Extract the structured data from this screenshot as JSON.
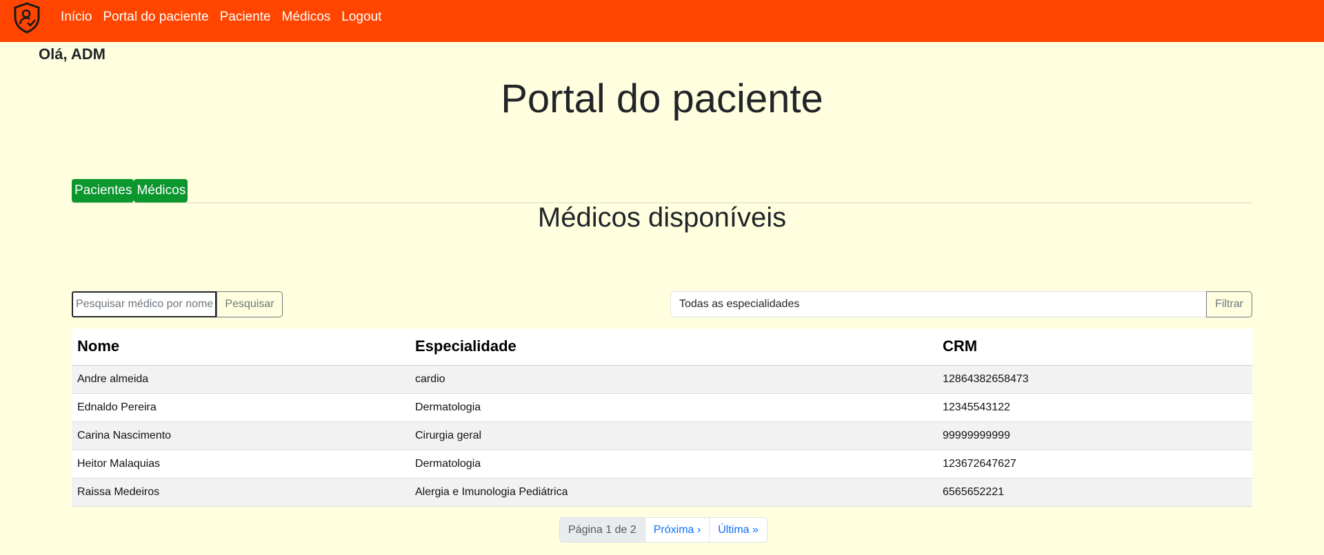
{
  "nav": {
    "links": [
      "Início",
      "Portal do paciente",
      "Paciente",
      "Médicos",
      "Logout"
    ]
  },
  "greeting": "Olá, ADM",
  "page_title": "Portal do paciente",
  "tabs": [
    "Pacientes",
    "Médicos"
  ],
  "section_title": "Médicos disponíveis",
  "search": {
    "placeholder": "Pesquisar médico por nome",
    "button": "Pesquisar"
  },
  "filter": {
    "selected": "Todas as especialidades",
    "button": "Filtrar"
  },
  "table": {
    "headers": [
      "Nome",
      "Especialidade",
      "CRM"
    ],
    "rows": [
      [
        "Andre almeida",
        "cardio",
        "12864382658473"
      ],
      [
        "Ednaldo Pereira",
        "Dermatologia",
        "12345543122"
      ],
      [
        "Carina Nascimento",
        "Cirurgia geral",
        "99999999999"
      ],
      [
        "Heitor Malaquias",
        "Dermatologia",
        "123672647627"
      ],
      [
        "Raissa Medeiros",
        "Alergia e Imunologia Pediátrica",
        "6565652221"
      ]
    ]
  },
  "pagination": {
    "current": "Página 1 de 2",
    "next": "Próxima ›",
    "last": "Última »"
  },
  "colors": {
    "navbar": "#ff4500",
    "background": "#ffffdf",
    "tab_button": "#0b962e",
    "link": "#0d6efd"
  }
}
